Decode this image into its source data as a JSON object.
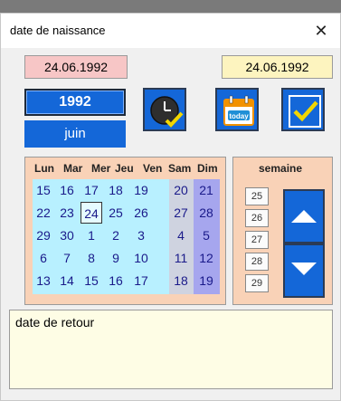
{
  "window": {
    "title": "date de naissance",
    "close_glyph": "✕"
  },
  "dates": {
    "left_date": "24.06.1992",
    "right_date": "24.06.1992"
  },
  "selector": {
    "year": "1992",
    "month": "juin"
  },
  "buttons": {
    "clock_icon": "clock-check-icon",
    "today_icon": "calendar-today-icon",
    "today_label": "today",
    "ok_icon": "checkmark-icon"
  },
  "calendar": {
    "day_headers": [
      "Lun",
      "Mar",
      "Mer",
      "Jeu",
      "Ven",
      "Sam",
      "Dim"
    ],
    "weeks": [
      [
        "15",
        "16",
        "17",
        "18",
        "19",
        "20",
        "21"
      ],
      [
        "22",
        "23",
        "24",
        "25",
        "26",
        "27",
        "28"
      ],
      [
        "29",
        "30",
        "1",
        "2",
        "3",
        "4",
        "5"
      ],
      [
        "6",
        "7",
        "8",
        "9",
        "10",
        "11",
        "12"
      ],
      [
        "13",
        "14",
        "15",
        "16",
        "17",
        "18",
        "19"
      ]
    ],
    "selected_day": "24"
  },
  "weeks_panel": {
    "title": "semaine",
    "numbers": [
      "25",
      "26",
      "27",
      "28",
      "29"
    ]
  },
  "notes": {
    "value": "date de retour"
  },
  "colors": {
    "accent_blue": "#1467d8",
    "left_date_bg": "#f7c6c6",
    "right_date_bg": "#fdf4bf",
    "panel_bg": "#f9d2b7",
    "weekday_bg": "#b8f0ff",
    "sunday_bg": "#a6a6ee"
  }
}
